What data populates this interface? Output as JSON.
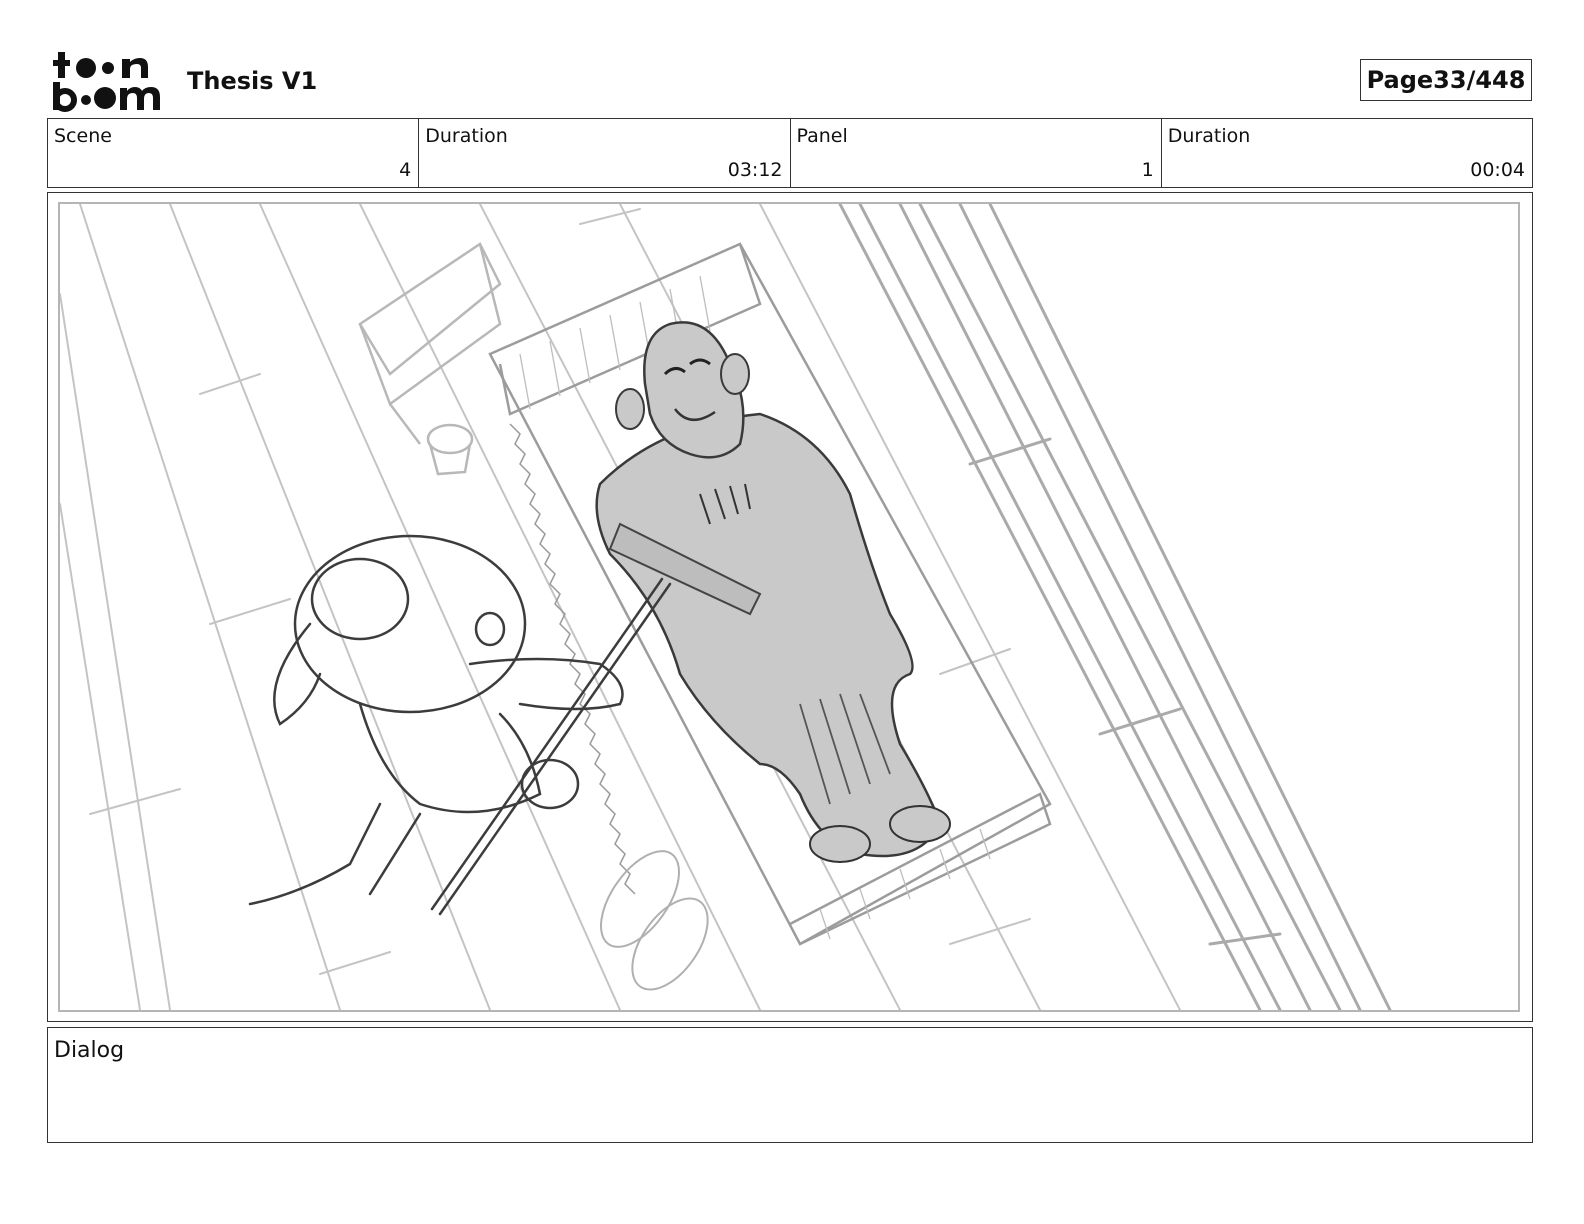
{
  "header": {
    "logo_text_line1": "toon",
    "logo_text_line2": "boom",
    "title": "Thesis V1",
    "page_label": "Page",
    "page_number": "33/448"
  },
  "info": [
    {
      "label": "Scene",
      "value": "4"
    },
    {
      "label": "Duration",
      "value": "03:12"
    },
    {
      "label": "Panel",
      "value": "1"
    },
    {
      "label": "Duration",
      "value": "00:04"
    }
  ],
  "dialog": {
    "label": "Dialog",
    "text": ""
  },
  "panel_image": {
    "description_icon": "storyboard-sketch-icon"
  }
}
